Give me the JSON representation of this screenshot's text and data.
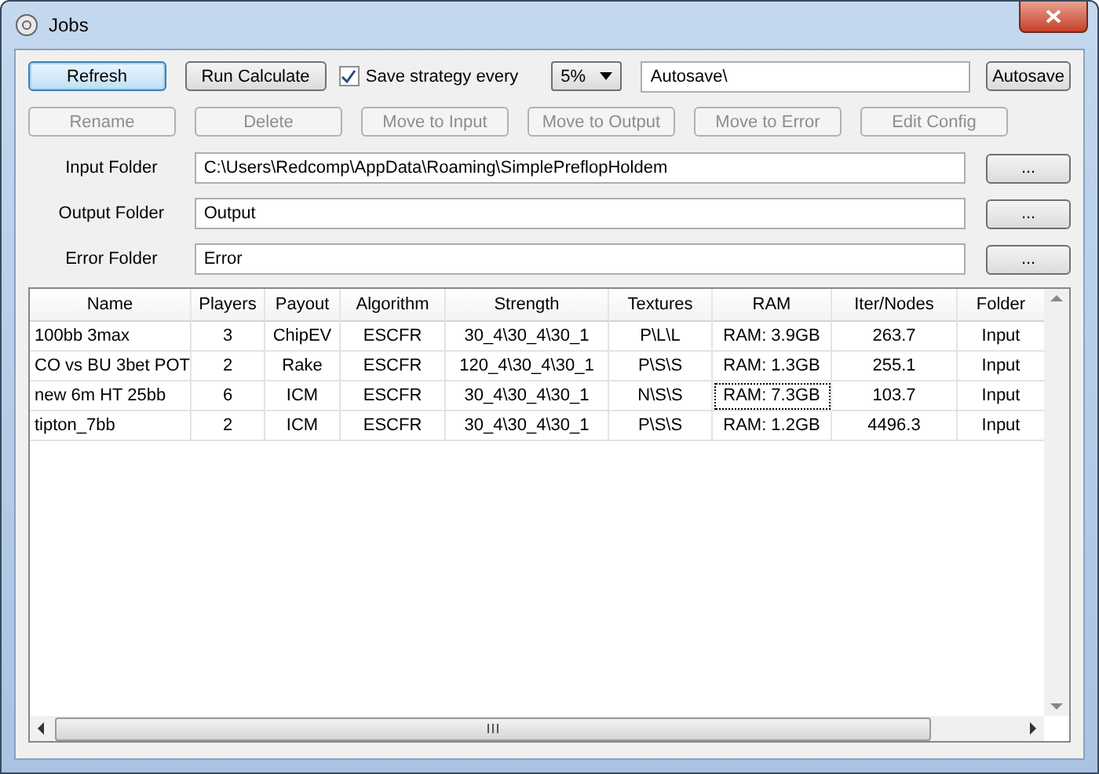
{
  "window": {
    "title": "Jobs"
  },
  "toolbar": {
    "buttons": [
      {
        "label": "Refresh",
        "focused": true
      },
      {
        "label": "Run Calculate",
        "focused": false
      }
    ],
    "save_strategy": {
      "label": "Save strategy every",
      "checked": true
    },
    "interval": {
      "value": "5%"
    },
    "autosave_path": {
      "value": "Autosave\\"
    },
    "autosave_button": {
      "label": "Autosave"
    }
  },
  "actions": [
    {
      "label": "Rename",
      "disabled": true
    },
    {
      "label": "Delete",
      "disabled": true
    },
    {
      "label": "Move to Input",
      "disabled": true
    },
    {
      "label": "Move to Output",
      "disabled": true
    },
    {
      "label": "Move to Error",
      "disabled": true
    },
    {
      "label": "Edit Config",
      "disabled": true
    }
  ],
  "folders": [
    {
      "label": "Input Folder",
      "value": "C:\\Users\\Redcomp\\AppData\\Roaming\\SimplePreflopHoldem",
      "browse": "..."
    },
    {
      "label": "Output Folder",
      "value": "Output",
      "browse": "..."
    },
    {
      "label": "Error Folder",
      "value": "Error",
      "browse": "..."
    }
  ],
  "table": {
    "columns": [
      "Name",
      "Players",
      "Payout",
      "Algorithm",
      "Strength",
      "Textures",
      "RAM",
      "Iter/Nodes",
      "Folder"
    ],
    "rows": [
      {
        "cells": [
          "100bb 3max",
          "3",
          "ChipEV",
          "ESCFR",
          "30_4\\30_4\\30_1",
          "P\\L\\L",
          "RAM: 3.9GB",
          "263.7",
          "Input"
        ],
        "focused": false
      },
      {
        "cells": [
          "CO vs BU 3bet POT",
          "2",
          "Rake",
          "ESCFR",
          "120_4\\30_4\\30_1",
          "P\\S\\S",
          "RAM: 1.3GB",
          "255.1",
          "Input"
        ],
        "focused": false
      },
      {
        "cells": [
          "new 6m HT 25bb",
          "6",
          "ICM",
          "ESCFR",
          "30_4\\30_4\\30_1",
          "N\\S\\S",
          "RAM: 7.3GB",
          "103.7",
          "Input"
        ],
        "focused": true
      },
      {
        "cells": [
          "tipton_7bb",
          "2",
          "ICM",
          "ESCFR",
          "30_4\\30_4\\30_1",
          "P\\S\\S",
          "RAM: 1.2GB",
          "4496.3",
          "Input"
        ],
        "focused": false
      }
    ]
  }
}
